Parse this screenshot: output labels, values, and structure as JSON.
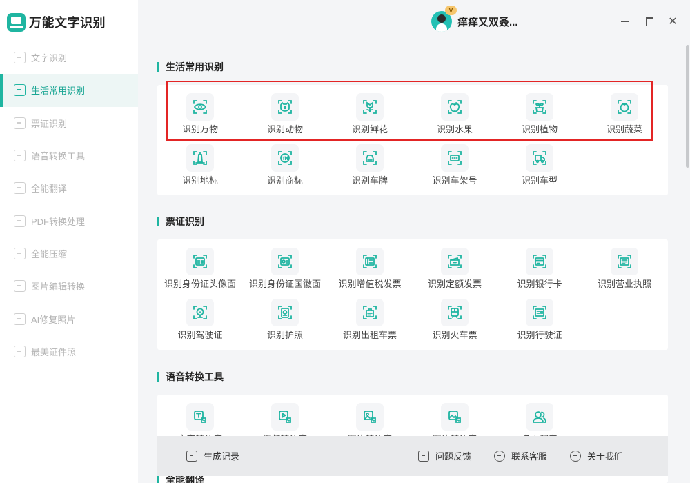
{
  "app": {
    "name": "万能文字识别",
    "logo_icon": "scanner-logo-icon",
    "accent": "#1fb5a1"
  },
  "sidebar": {
    "items": [
      {
        "label": "文字识别",
        "icon": "text-scan-icon",
        "active": false
      },
      {
        "label": "生活常用识别",
        "icon": "scan-life-icon",
        "active": true
      },
      {
        "label": "票证识别",
        "icon": "ticket-icon",
        "active": false
      },
      {
        "label": "语音转换工具",
        "icon": "speech-icon",
        "active": false
      },
      {
        "label": "全能翻译",
        "icon": "translate-icon",
        "active": false
      },
      {
        "label": "PDF转换处理",
        "icon": "pdf-icon",
        "active": false
      },
      {
        "label": "全能压缩",
        "icon": "compress-icon",
        "active": false
      },
      {
        "label": "图片编辑转换",
        "icon": "image-edit-icon",
        "active": false
      },
      {
        "label": "AI修复照片",
        "icon": "ai-repair-icon",
        "active": false
      },
      {
        "label": "最美证件照",
        "icon": "id-photo-icon",
        "active": false
      }
    ]
  },
  "header": {
    "username": "痒痒又双叒...",
    "vip_badge": "V",
    "window_controls": {
      "minimize": "minimize-icon",
      "maximize": "maximize-icon",
      "close": "✕"
    }
  },
  "sections": [
    {
      "title": "生活常用识别",
      "items": [
        {
          "label": "识别万物",
          "icon": "eye-icon"
        },
        {
          "label": "识别动物",
          "icon": "animal-icon"
        },
        {
          "label": "识别鲜花",
          "icon": "flower-icon"
        },
        {
          "label": "识别水果",
          "icon": "apple-icon"
        },
        {
          "label": "识别植物",
          "icon": "plant-icon"
        },
        {
          "label": "识别蔬菜",
          "icon": "vegetable-icon"
        },
        {
          "label": "识别地标",
          "icon": "landmark-icon"
        },
        {
          "label": "识别商标",
          "icon": "trademark-icon"
        },
        {
          "label": "识别车牌",
          "icon": "car-icon"
        },
        {
          "label": "识别车架号",
          "icon": "vin-icon"
        },
        {
          "label": "识别车型",
          "icon": "truck-icon"
        }
      ]
    },
    {
      "title": "票证识别",
      "items": [
        {
          "label": "识别身份证头像面",
          "icon": "id-card-front-icon"
        },
        {
          "label": "识别身份证国徽面",
          "icon": "id-card-back-icon"
        },
        {
          "label": "识别增值税发票",
          "icon": "vat-invoice-icon"
        },
        {
          "label": "识别定额发票",
          "icon": "quota-invoice-icon"
        },
        {
          "label": "识别银行卡",
          "icon": "bank-card-icon"
        },
        {
          "label": "识别营业执照",
          "icon": "business-license-icon"
        },
        {
          "label": "识别驾驶证",
          "icon": "driver-license-icon"
        },
        {
          "label": "识别护照",
          "icon": "passport-icon"
        },
        {
          "label": "识别出租车票",
          "icon": "taxi-icon"
        },
        {
          "label": "识别火车票",
          "icon": "train-icon"
        },
        {
          "label": "识别行驶证",
          "icon": "vehicle-license-icon"
        }
      ]
    },
    {
      "title": "语音转换工具",
      "items": [
        {
          "label": "文字转语音",
          "icon": "text-to-speech-icon"
        },
        {
          "label": "视频转语音",
          "icon": "video-to-speech-icon"
        },
        {
          "label": "图片转语音",
          "icon": "image-to-speech-icon"
        },
        {
          "label": "图片转语音",
          "icon": "image-speech-icon"
        },
        {
          "label": "多人配音",
          "icon": "users-icon"
        }
      ]
    }
  ],
  "next_section_title": "全能翻译",
  "bottom_bar": {
    "history": {
      "label": "生成记录",
      "icon": "history-icon"
    },
    "feedback": {
      "label": "问题反馈",
      "icon": "feedback-icon"
    },
    "support": {
      "label": "联系客服",
      "icon": "support-icon"
    },
    "about": {
      "label": "关于我们",
      "icon": "info-icon"
    }
  }
}
